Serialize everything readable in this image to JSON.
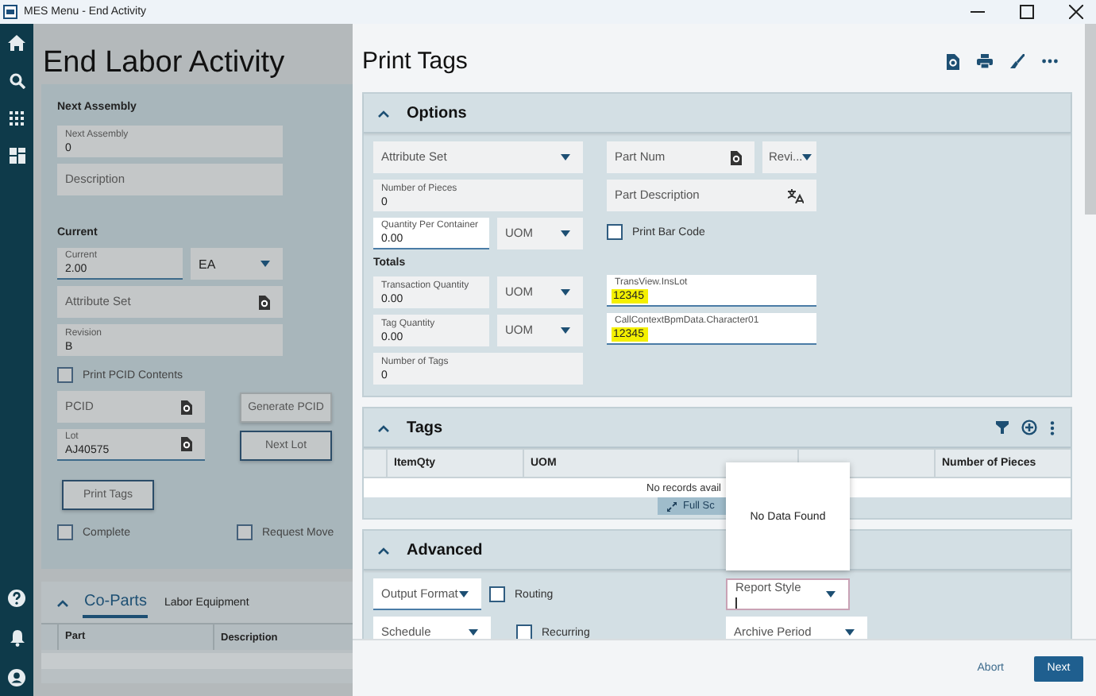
{
  "window": {
    "title": "MES Menu - End Activity"
  },
  "page": {
    "title": "End Labor Activity",
    "next_assembly_heading": "Next Assembly",
    "next_assembly": {
      "label": "Next Assembly",
      "value": "0",
      "kind": "text"
    },
    "description": {
      "label": "Description",
      "kind": "text"
    },
    "current_heading": "Current",
    "current": {
      "label": "Current",
      "value": "2.00",
      "kind": "text",
      "editable": true
    },
    "current_uom": {
      "value": "EA",
      "kind": "dropdown"
    },
    "attribute_set": {
      "label": "Attribute Set",
      "kind": "lookup"
    },
    "revision": {
      "label": "Revision",
      "value": "B",
      "kind": "text"
    },
    "print_pcid_contents": {
      "label": "Print PCID Contents",
      "checked": false
    },
    "pcid": {
      "label": "PCID",
      "kind": "lookup"
    },
    "generate_pcid_button": "Generate PCID",
    "lot": {
      "label": "Lot",
      "value": "AJ40575",
      "kind": "lookup",
      "editable": true
    },
    "next_lot_button": "Next Lot",
    "print_tags_button": "Print Tags",
    "complete": {
      "label": "Complete",
      "checked": false
    },
    "request_move": {
      "label": "Request Move",
      "checked": false
    },
    "section": {
      "expanded": true,
      "tabs": [
        {
          "label": "Co-Parts",
          "selected": true
        },
        {
          "label": "Labor Equipment",
          "selected": false
        }
      ],
      "columns": [
        "Part",
        "Description"
      ]
    }
  },
  "dialog": {
    "title": "Print Tags",
    "options": {
      "title": "Options",
      "expanded": true,
      "attribute_set": {
        "label": "Attribute Set",
        "kind": "dropdown",
        "editable": false
      },
      "number_of_pieces": {
        "label": "Number of Pieces",
        "value": "0",
        "kind": "text",
        "editable": false
      },
      "quantity_per_container": {
        "label": "Quantity Per Container",
        "value": "0.00",
        "kind": "text",
        "editable": true
      },
      "qpc_uom": {
        "label": "UOM",
        "kind": "dropdown",
        "editable": false
      },
      "totals_heading": "Totals",
      "transaction_quantity": {
        "label": "Transaction Quantity",
        "value": "0.00",
        "kind": "text",
        "editable": false
      },
      "transaction_uom": {
        "label": "UOM",
        "kind": "dropdown",
        "editable": false
      },
      "tag_quantity": {
        "label": "Tag Quantity",
        "value": "0.00",
        "kind": "text",
        "editable": false
      },
      "tag_uom": {
        "label": "UOM",
        "kind": "dropdown",
        "editable": false
      },
      "number_of_tags": {
        "label": "Number of Tags",
        "value": "0",
        "kind": "text",
        "editable": false
      },
      "part_num": {
        "label": "Part Num",
        "kind": "lookup",
        "editable": false
      },
      "revision": {
        "label": "Revi...",
        "kind": "dropdown",
        "editable": false
      },
      "part_description": {
        "label": "Part Description",
        "kind": "translate",
        "editable": false
      },
      "print_bar_code": {
        "label": "Print Bar Code",
        "checked": false
      },
      "trans_view": {
        "label": "TransView.InsLot",
        "value": "12345",
        "kind": "text",
        "editable": true,
        "highlighted": true
      },
      "call_context": {
        "label": "CallContextBpmData.Character01",
        "value": "12345",
        "kind": "text",
        "editable": true,
        "highlighted": true
      }
    },
    "tags": {
      "title": "Tags",
      "expanded": true,
      "columns": [
        {
          "label": "ItemQty"
        },
        {
          "label": "UOM"
        },
        {},
        {
          "label": "Number of Pieces"
        }
      ],
      "empty_message": "No records avail",
      "full_screen_button": "Full Sc"
    },
    "popup": {
      "message": "No Data Found"
    },
    "advanced": {
      "title": "Advanced",
      "expanded": true,
      "output_format": {
        "label": "Output Format",
        "kind": "dropdown",
        "editable": true
      },
      "routing": {
        "label": "Routing",
        "checked": false
      },
      "report_style": {
        "label": "Report Style",
        "kind": "dropdown",
        "editable": true,
        "focused": true
      },
      "schedule": {
        "label": "Schedule",
        "kind": "dropdown",
        "editable": true
      },
      "recurring": {
        "label": "Recurring",
        "checked": false
      },
      "archive_period": {
        "label": "Archive Period",
        "kind": "dropdown",
        "editable": true
      }
    },
    "buttons": [
      {
        "label": "Abort",
        "kind": "link"
      },
      {
        "label": "Next",
        "kind": "primary"
      }
    ]
  }
}
